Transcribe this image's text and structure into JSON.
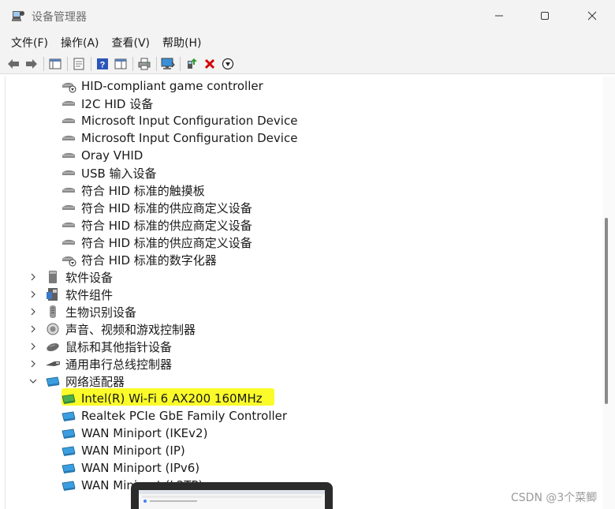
{
  "window": {
    "title": "设备管理器"
  },
  "menu": [
    {
      "label": "文件(F)"
    },
    {
      "label": "操作(A)"
    },
    {
      "label": "查看(V)"
    },
    {
      "label": "帮助(H)"
    }
  ],
  "toolbar": {
    "icons": [
      "back-arrow-icon",
      "forward-arrow-icon",
      "properties-grid-icon",
      "update-driver-icon",
      "help-icon",
      "console-tree-icon",
      "print-icon",
      "monitor-scan-icon",
      "add-driver-icon",
      "uninstall-x-icon",
      "download-arrow-icon"
    ]
  },
  "tree": {
    "hid_children": [
      {
        "label": "HID-compliant game controller"
      },
      {
        "label": "I2C HID 设备"
      },
      {
        "label": "Microsoft Input Configuration Device"
      },
      {
        "label": "Microsoft Input Configuration Device"
      },
      {
        "label": "Oray VHID"
      },
      {
        "label": "USB 输入设备"
      },
      {
        "label": "符合 HID 标准的触摸板"
      },
      {
        "label": "符合 HID 标准的供应商定义设备"
      },
      {
        "label": "符合 HID 标准的供应商定义设备"
      },
      {
        "label": "符合 HID 标准的供应商定义设备"
      },
      {
        "label": "符合 HID 标准的数字化器"
      }
    ],
    "categories": [
      {
        "label": "软件设备",
        "expanded": false
      },
      {
        "label": "软件组件",
        "expanded": false
      },
      {
        "label": "生物识别设备",
        "expanded": false
      },
      {
        "label": "声音、视频和游戏控制器",
        "expanded": false
      },
      {
        "label": "鼠标和其他指针设备",
        "expanded": false
      },
      {
        "label": "通用串行总线控制器",
        "expanded": false
      },
      {
        "label": "网络适配器",
        "expanded": true
      }
    ],
    "network_children": [
      {
        "label": "Intel(R) Wi-Fi 6 AX200 160MHz"
      },
      {
        "label": "Realtek PCIe GbE Family Controller"
      },
      {
        "label": "WAN Miniport (IKEv2)"
      },
      {
        "label": "WAN Miniport (IP)"
      },
      {
        "label": "WAN Miniport (IPv6)"
      },
      {
        "label": "WAN Miniport (L2TP)"
      }
    ]
  },
  "watermark": "CSDN @3个菜鲫",
  "colors": {
    "chrome": "#f3f3f3",
    "highlight": "#fbfb2a",
    "uninstall_red": "#d40000",
    "network_icon_blue": "#3a9ee0"
  }
}
